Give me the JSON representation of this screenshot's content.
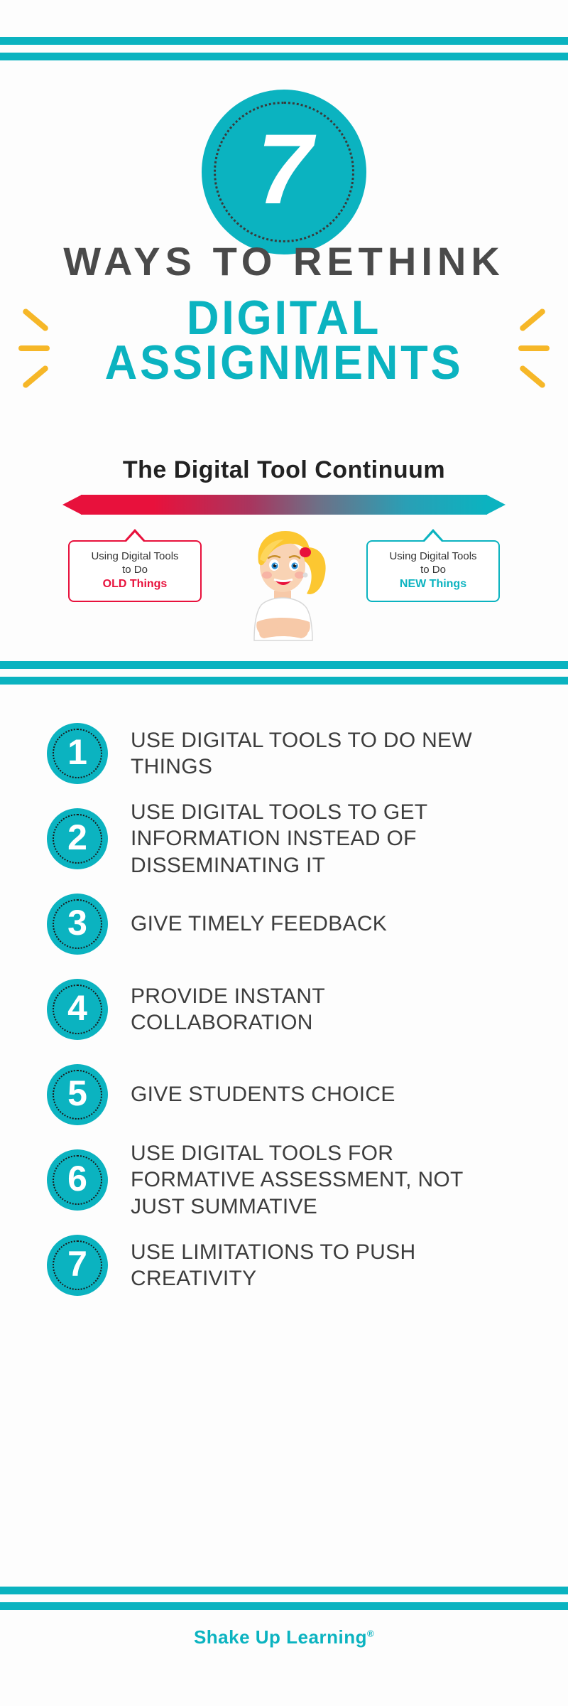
{
  "theme": {
    "teal": "#0bb3c0",
    "red": "#e8113c",
    "yellow": "#f6b728",
    "dark_gray": "#4a4a4a",
    "text_gray": "#3d3d3d",
    "background": "#fdfdfd"
  },
  "hero": {
    "number": "7",
    "line1": "WAYS TO RETHINK",
    "line2": "DIGITAL",
    "line3": "ASSIGNMENTS"
  },
  "continuum": {
    "title": "The Digital Tool Continuum",
    "arrow_left_color": "#e8113c",
    "arrow_right_color": "#0bb3c0",
    "left_bubble": {
      "line1": "Using Digital Tools",
      "line2": "to Do",
      "emphasis": "OLD Things"
    },
    "right_bubble": {
      "line1": "Using Digital Tools",
      "line2": "to Do",
      "emphasis": "NEW Things"
    }
  },
  "list": {
    "items": [
      {
        "number": "1",
        "text": "USE DIGITAL TOOLS TO DO NEW THINGS"
      },
      {
        "number": "2",
        "text": "USE DIGITAL TOOLS TO GET INFORMATION INSTEAD OF DISSEMINATING IT"
      },
      {
        "number": "3",
        "text": "GIVE TIMELY FEEDBACK"
      },
      {
        "number": "4",
        "text": "PROVIDE INSTANT COLLABORATION"
      },
      {
        "number": "5",
        "text": "GIVE STUDENTS CHOICE"
      },
      {
        "number": "6",
        "text": "USE DIGITAL TOOLS FOR FORMATIVE ASSESSMENT, NOT JUST SUMMATIVE"
      },
      {
        "number": "7",
        "text": "USE LIMITATIONS TO PUSH CREATIVITY"
      }
    ]
  },
  "footer": {
    "brand_part1": "Shake Up Learning",
    "registered": "®"
  }
}
